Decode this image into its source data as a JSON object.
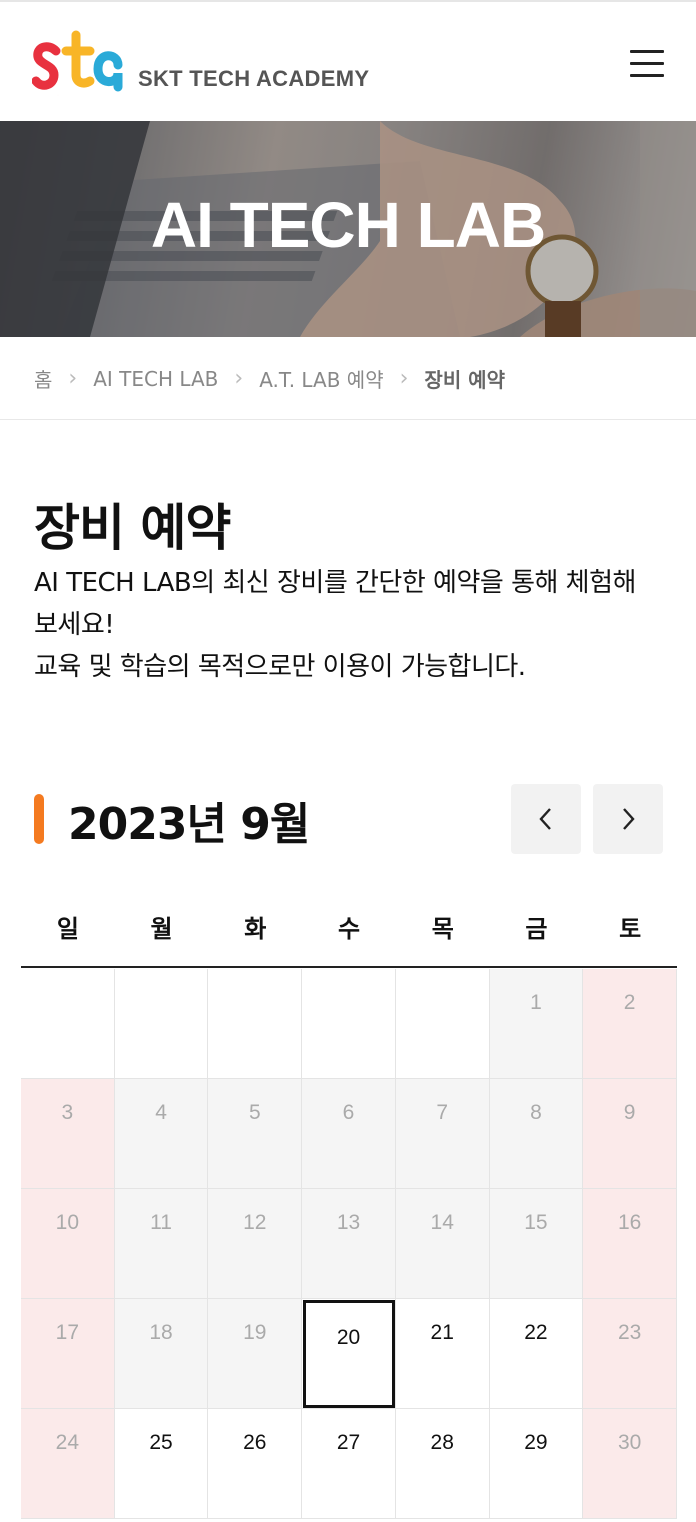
{
  "header": {
    "logo_text": "SKT TECH ACADEMY",
    "colors": {
      "logo_s": "#e8313f",
      "logo_t": "#f8b527",
      "logo_a": "#2aaad8"
    }
  },
  "hero": {
    "title": "AI TECH LAB"
  },
  "breadcrumb": {
    "items": [
      "홈",
      "AI TECH LAB",
      "A.T. LAB 예약",
      "장비 예약"
    ]
  },
  "page": {
    "title": "장비 예약",
    "description_line1": "AI TECH LAB의 최신 장비를 간단한 예약을 통해 체험해 보세요!",
    "description_line2": "교육 및 학습의 목적으로만 이용이 가능합니다."
  },
  "calendar": {
    "title": "2023년 9월",
    "accent_color": "#f47a20",
    "weekdays": [
      "일",
      "월",
      "화",
      "수",
      "목",
      "금",
      "토"
    ],
    "selected_day": "20",
    "weeks": [
      [
        {
          "day": "",
          "state": "empty"
        },
        {
          "day": "",
          "state": "empty"
        },
        {
          "day": "",
          "state": "empty"
        },
        {
          "day": "",
          "state": "empty"
        },
        {
          "day": "",
          "state": "empty"
        },
        {
          "day": "1",
          "state": "past"
        },
        {
          "day": "2",
          "state": "weekend"
        }
      ],
      [
        {
          "day": "3",
          "state": "weekend"
        },
        {
          "day": "4",
          "state": "past"
        },
        {
          "day": "5",
          "state": "past"
        },
        {
          "day": "6",
          "state": "past"
        },
        {
          "day": "7",
          "state": "past"
        },
        {
          "day": "8",
          "state": "past"
        },
        {
          "day": "9",
          "state": "weekend"
        }
      ],
      [
        {
          "day": "10",
          "state": "weekend"
        },
        {
          "day": "11",
          "state": "past"
        },
        {
          "day": "12",
          "state": "past"
        },
        {
          "day": "13",
          "state": "past"
        },
        {
          "day": "14",
          "state": "past"
        },
        {
          "day": "15",
          "state": "past"
        },
        {
          "day": "16",
          "state": "weekend"
        }
      ],
      [
        {
          "day": "17",
          "state": "weekend"
        },
        {
          "day": "18",
          "state": "past"
        },
        {
          "day": "19",
          "state": "past"
        },
        {
          "day": "20",
          "state": "today"
        },
        {
          "day": "21",
          "state": "available"
        },
        {
          "day": "22",
          "state": "available"
        },
        {
          "day": "23",
          "state": "weekend"
        }
      ],
      [
        {
          "day": "24",
          "state": "weekend"
        },
        {
          "day": "25",
          "state": "available"
        },
        {
          "day": "26",
          "state": "available"
        },
        {
          "day": "27",
          "state": "available"
        },
        {
          "day": "28",
          "state": "available"
        },
        {
          "day": "29",
          "state": "available"
        },
        {
          "day": "30",
          "state": "weekend"
        }
      ]
    ]
  },
  "icons": {
    "menu": "hamburger-menu-icon",
    "prev": "chevron-left-icon",
    "next": "chevron-right-icon",
    "breadcrumb_sep": "chevron-right-icon"
  }
}
